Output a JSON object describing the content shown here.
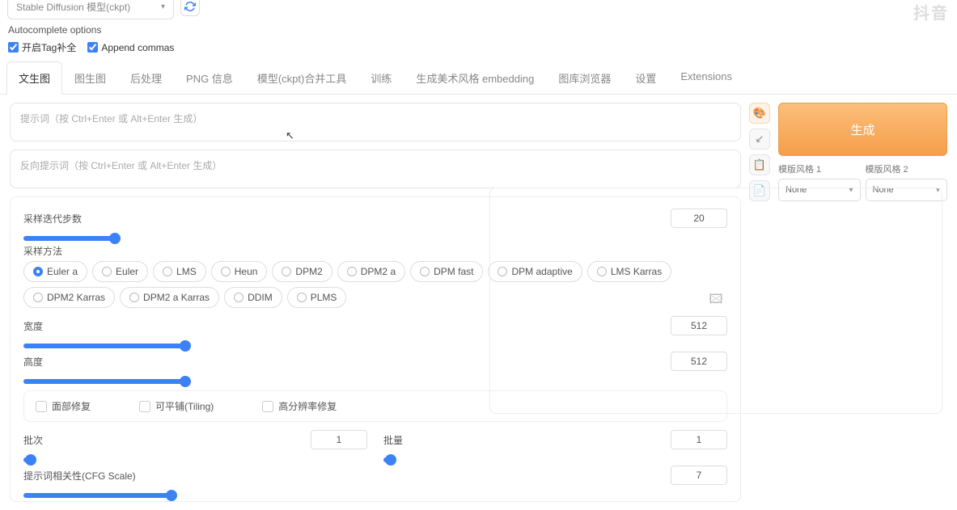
{
  "header": {
    "model_placeholder": "Stable Diffusion 模型(ckpt)",
    "autocomplete_label": "Autocomplete options",
    "checkbox1": "开启Tag补全",
    "checkbox2": "Append commas"
  },
  "tabs": [
    "文生图",
    "图生图",
    "后处理",
    "PNG 信息",
    "模型(ckpt)合并工具",
    "训练",
    "生成美术风格 embedding",
    "图库浏览器",
    "设置",
    "Extensions"
  ],
  "prompts": {
    "positive_placeholder": "提示词（按 Ctrl+Enter 或 Alt+Enter 生成）",
    "negative_placeholder": "反向提示词（按 Ctrl+Enter 或 Alt+Enter 生成）"
  },
  "sampling": {
    "steps_label": "采样迭代步数",
    "steps_value": "20",
    "method_label": "采样方法",
    "methods": [
      "Euler a",
      "Euler",
      "LMS",
      "Heun",
      "DPM2",
      "DPM2 a",
      "DPM fast",
      "DPM adaptive",
      "LMS Karras",
      "DPM2 Karras",
      "DPM2 a Karras",
      "DDIM",
      "PLMS"
    ],
    "selected_method": "Euler a"
  },
  "dimensions": {
    "width_label": "宽度",
    "width_value": "512",
    "height_label": "高度",
    "height_value": "512"
  },
  "options": {
    "face_restore": "面部修复",
    "tiling": "可平铺(Tiling)",
    "hires": "高分辨率修复"
  },
  "batch": {
    "count_label": "批次",
    "count_value": "1",
    "size_label": "批量",
    "size_value": "1"
  },
  "cfg": {
    "label": "提示词相关性(CFG Scale)",
    "value": "7"
  },
  "generate": {
    "button": "生成",
    "style1_label": "模版风格 1",
    "style2_label": "模版风格 2",
    "none": "None"
  },
  "icons": {
    "palette": "🎨",
    "arrow": "↙",
    "clipboard": "📋",
    "list": "📄",
    "image": "🖾"
  }
}
